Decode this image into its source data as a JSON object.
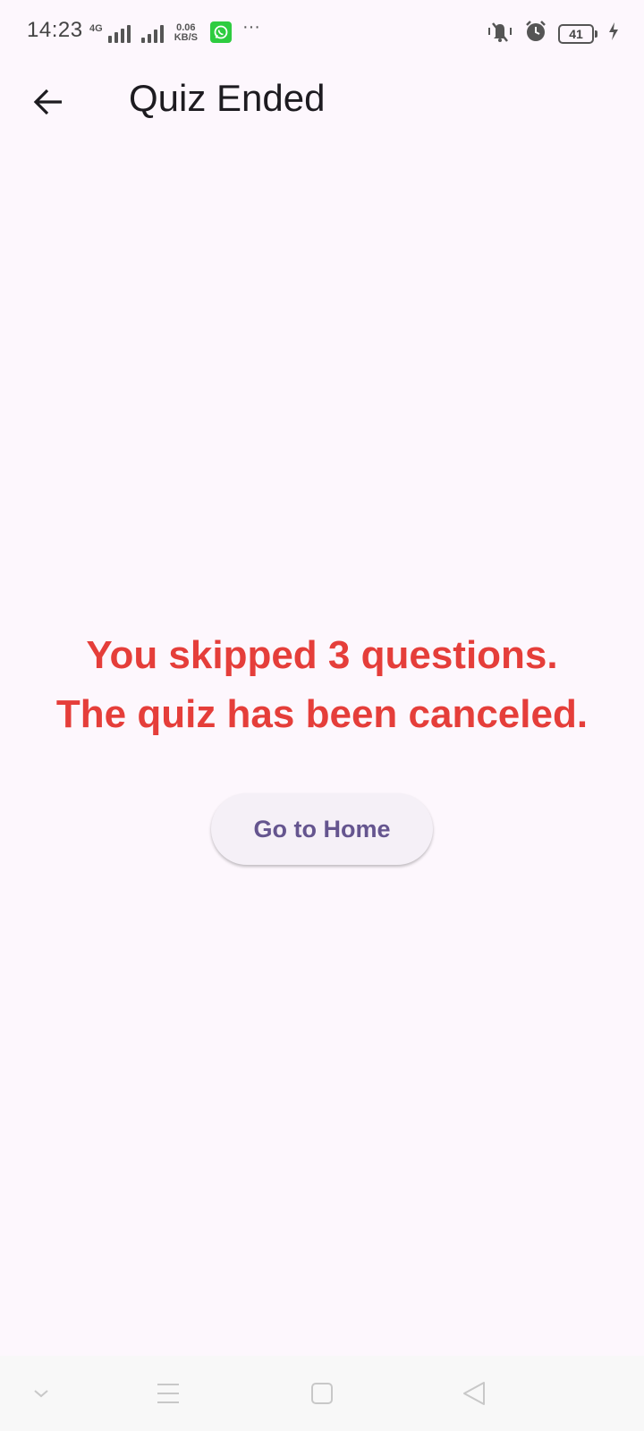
{
  "status_bar": {
    "time": "14:23",
    "network_type": "4G",
    "speed_value": "0.06",
    "speed_unit": "KB/S",
    "more_dots": "···",
    "battery_level": "41",
    "icons": [
      "signal-icon",
      "whatsapp-icon",
      "silent-icon",
      "alarm-icon",
      "battery-icon",
      "charging-icon"
    ]
  },
  "app_bar": {
    "title": "Quiz Ended"
  },
  "main": {
    "message_line1": "You skipped 3 questions.",
    "message_line2": "The quiz has been canceled.",
    "home_button_label": "Go to Home"
  },
  "colors": {
    "background": "#fdf7fd",
    "message": "#e53e3a",
    "button_text": "#65558f",
    "button_bg": "#f5f0f7"
  },
  "nav_bar": {
    "icons": [
      "collapse-icon",
      "menu-icon",
      "home-icon",
      "back-icon"
    ]
  }
}
